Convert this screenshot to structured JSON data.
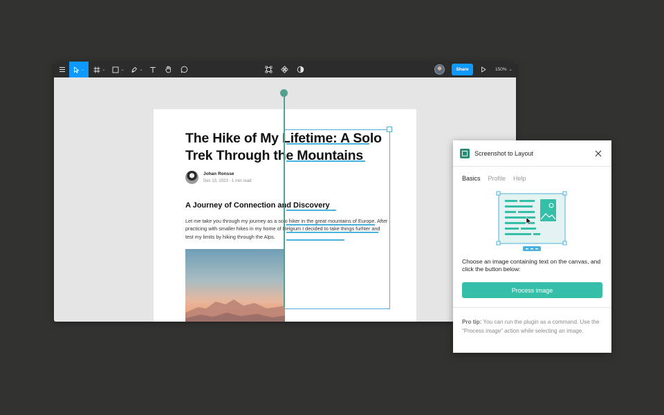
{
  "toolbar": {
    "zoom": "150%",
    "share_label": "Share",
    "caret": "⌄"
  },
  "article": {
    "title": "The Hike of My Lifetime: A Solo Trek Through the Mountains",
    "author_name": "Johan Ronsse",
    "author_meta": "Dec 13, 2023 · 1 min read",
    "subtitle": "A Journey of Connection and Discovery",
    "body": "Let me take you through my journey as a solo hiker in the great mountains of Europe. After practicing with smaller hikes in my home of Belgium I decided to take things furhter and test my limits by hiking through the Alps."
  },
  "panel": {
    "title": "Screenshot to Layout",
    "tabs": [
      "Basics",
      "Profile",
      "Help"
    ],
    "active_tab": "Basics",
    "description": "Choose an image containing text on the canvas, and click the button below:",
    "button_label": "Process image",
    "tip_label": "Pro tip:",
    "tip_text": " You can run the plugin as a command. Use the “Process image” action while selecting an image."
  },
  "colors": {
    "background": "#323231",
    "toolbar": "#2c2c2c",
    "accent_blue": "#0d99ff",
    "selection_blue": "#4ab1dc",
    "guide_teal": "#52a08f",
    "button_teal": "#36bfa8"
  }
}
